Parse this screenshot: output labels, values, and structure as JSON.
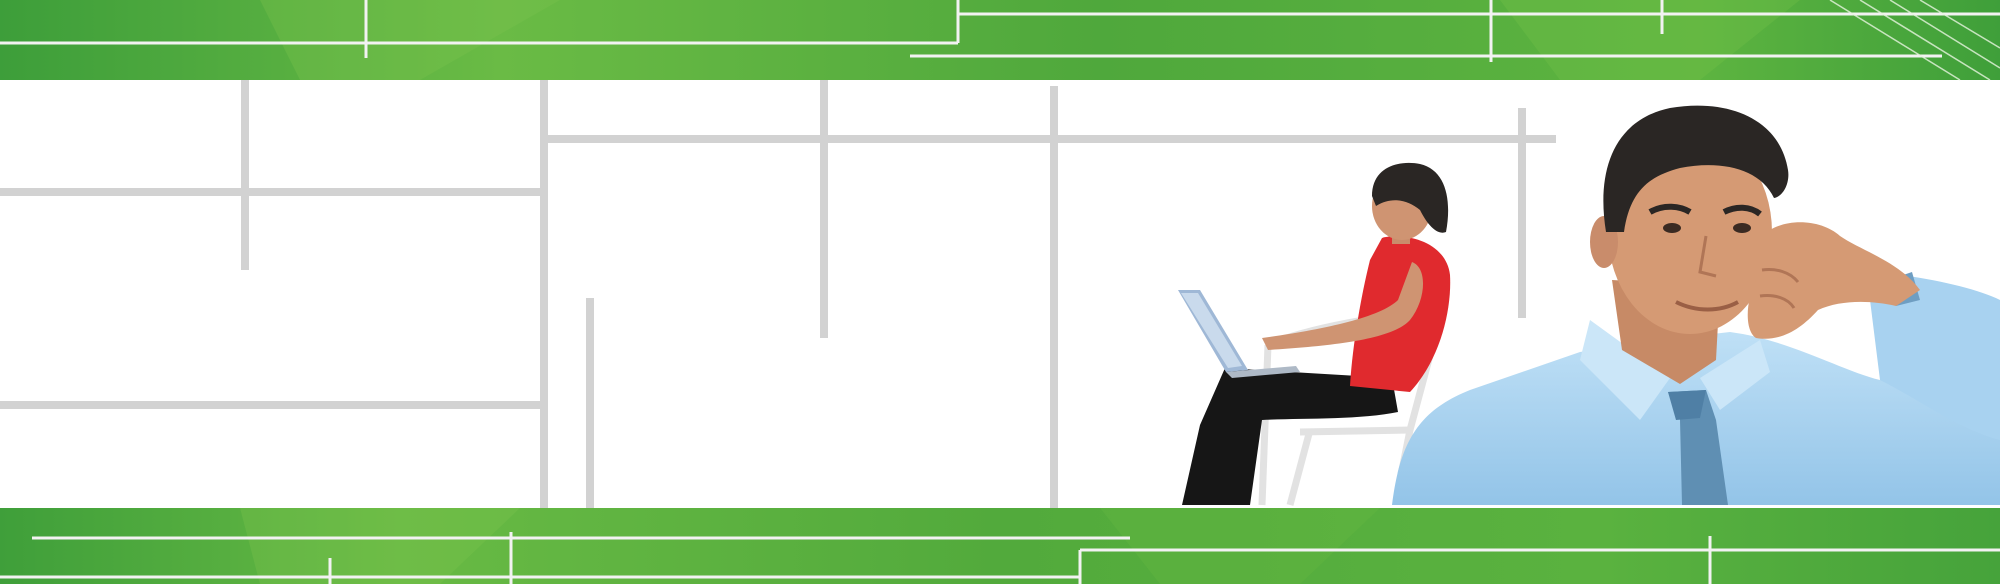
{
  "banner": {
    "colors": {
      "band_green": "#54ac3c",
      "band_green_light": "#6fbd44",
      "band_green_dark": "#3a9a3a",
      "line_white": "#f2f2f2",
      "grey_line": "#d2d2d2",
      "background": "#ffffff",
      "shirt_blue": "#a9d3f0",
      "tie_blue": "#5f8fb3",
      "skin": "#d59a74",
      "hair": "#2a2624",
      "top_red": "#e02a2e",
      "pants_black": "#161616",
      "laptop": "#b8c9de",
      "chair": "#e6e6e6"
    },
    "photo": {
      "woman": "woman-with-laptop",
      "man": "man-in-blue-shirt-and-tie"
    }
  }
}
